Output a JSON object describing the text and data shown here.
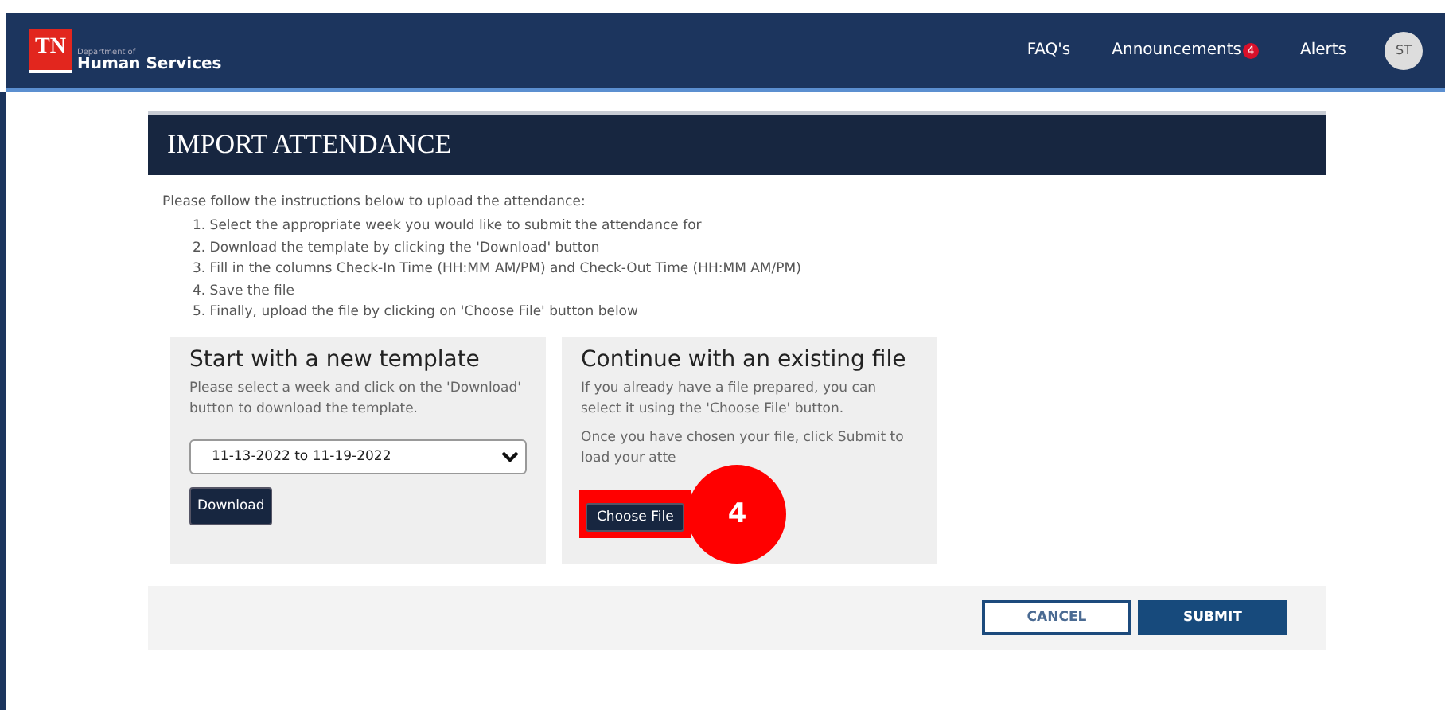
{
  "header": {
    "logo": "TN",
    "org_small": "Department of",
    "org_name": "Human Services",
    "nav": [
      {
        "label": "FAQ's"
      },
      {
        "label": "Announcements",
        "badge": "4"
      },
      {
        "label": "Alerts"
      }
    ],
    "avatar": "ST"
  },
  "page_title": "IMPORT ATTENDANCE",
  "intro": "Please follow the instructions below to upload the attendance:",
  "steps": [
    "1. Select the appropriate week you would like to submit the attendance for",
    "2. Download the template by clicking the 'Download' button",
    "3. Fill in the columns Check-In Time (HH:MM AM/PM) and Check-Out Time (HH:MM AM/PM)",
    "4. Save the file",
    "5. Finally, upload the file by clicking on 'Choose File' button below"
  ],
  "new_template": {
    "title": "Start with a new template",
    "text": "Please select a week and click on the 'Download' button to download the template.",
    "week": "11-13-2022 to 11-19-2022",
    "button": "Download"
  },
  "existing_file": {
    "title": "Continue with an existing file",
    "text": "If you already have a file prepared, you can select it using the 'Choose File' button.",
    "text2": "Once you have chosen your file, click Submit to load your atte",
    "button": "Choose File",
    "highlighted": true,
    "step_marker": "4"
  },
  "actions": [
    {
      "label": "CANCEL",
      "kind": "secondary"
    },
    {
      "label": "SUBMIT",
      "kind": "primary"
    }
  ]
}
